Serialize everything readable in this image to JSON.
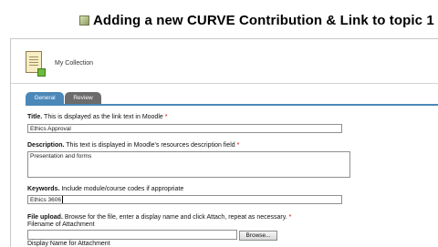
{
  "slide": {
    "title": "Adding a new CURVE Contribution & Link to topic 1"
  },
  "collection": {
    "label": "My Collection"
  },
  "tabs": [
    {
      "label": "General",
      "active": true
    },
    {
      "label": "Review",
      "active": false
    }
  ],
  "form": {
    "title": {
      "label": "Title.",
      "hint": "This is displayed as the link text in Moodle",
      "required_mark": "*",
      "value": "Ethics Approval"
    },
    "description": {
      "label": "Description.",
      "hint": "This text is displayed in Moodle's resources description field",
      "required_mark": "*",
      "value": "Presentation and forms"
    },
    "keywords": {
      "label": "Keywords.",
      "hint": "Include module/course codes if appropriate",
      "value": "Ethics 3606"
    },
    "file_upload": {
      "label": "File upload.",
      "hint": "Browse for the file, enter a display name and click Attach, repeat as necessary.",
      "required_mark": "*",
      "filename_label": "Filename of Attachment",
      "filename_value": "",
      "browse_label": "Browse...",
      "display_name_label": "Display Name for Attachment"
    }
  },
  "colors": {
    "tab_active": "#4a88b8",
    "tab_inactive": "#6c6c6c",
    "required": "#cc0000"
  }
}
